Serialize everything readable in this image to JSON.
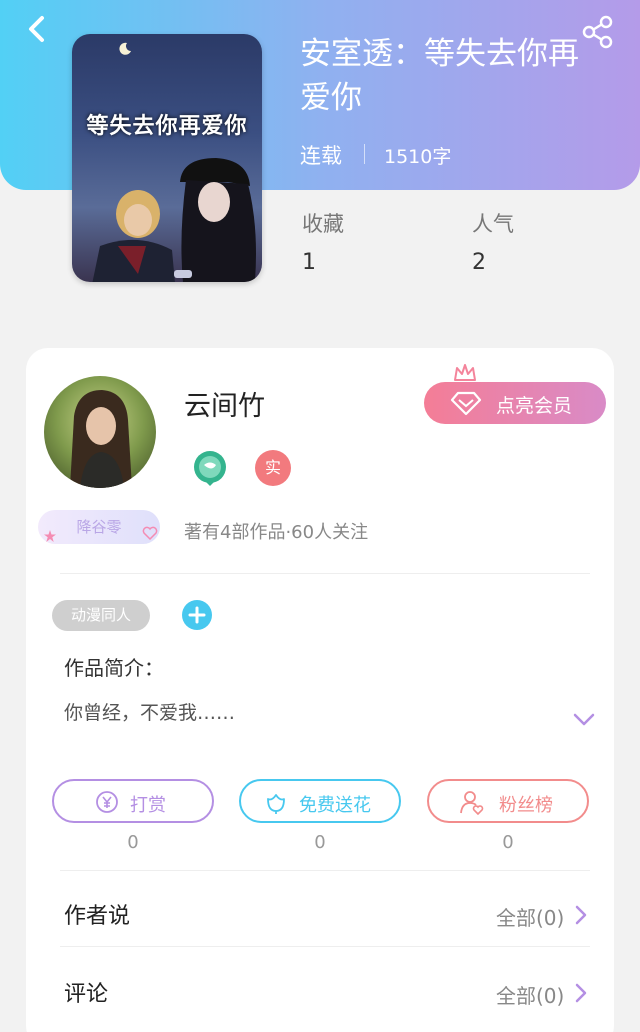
{
  "header": {
    "back_icon": "chevron-left-icon",
    "share_icon": "share-icon"
  },
  "book": {
    "cover_text": "等失去你再爱你",
    "title": "安室透：等失去你再爱你",
    "status": "连载",
    "word_count": "1510字"
  },
  "stats": [
    {
      "label": "收藏",
      "value": "1"
    },
    {
      "label": "人气",
      "value": "2"
    }
  ],
  "author": {
    "name": "云间竹",
    "member_button": "点亮会员",
    "badge_real": "实",
    "fan_tag": "降谷零",
    "meta": "著有4部作品·60人关注"
  },
  "tags": {
    "genre": "动漫同人"
  },
  "intro": {
    "label": "作品简介：",
    "text": "你曾经，不爱我……"
  },
  "actions": [
    {
      "label": "打赏",
      "count": "0",
      "icon": "yen-coin-icon",
      "color": "#b48fe3"
    },
    {
      "label": "免费送花",
      "count": "0",
      "icon": "flower-icon",
      "color": "#47c8ef"
    },
    {
      "label": "粉丝榜",
      "count": "0",
      "icon": "user-heart-icon",
      "color": "#f28c8c"
    }
  ],
  "rows": [
    {
      "label": "作者说",
      "link": "全部(0)"
    },
    {
      "label": "评论",
      "link": "全部(0)"
    }
  ],
  "colors": {
    "header_start": "#52d0f5",
    "header_end": "#b49be9",
    "accent_purple": "#b48fe3",
    "accent_cyan": "#47c8ef",
    "accent_pink": "#f28c8c"
  }
}
